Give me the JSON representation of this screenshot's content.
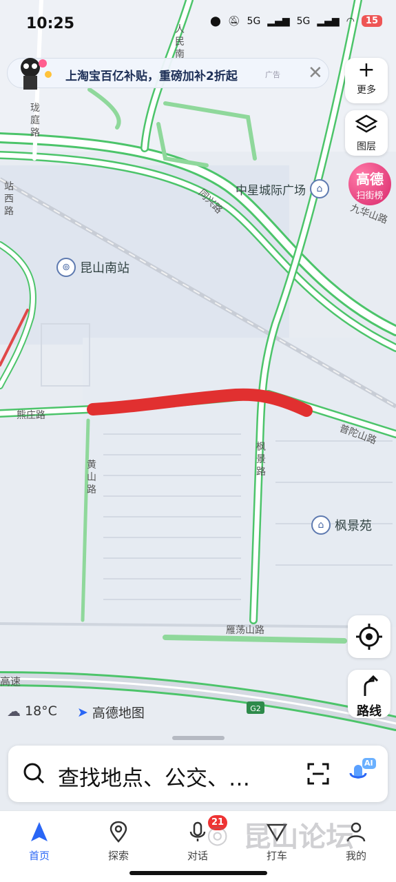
{
  "status": {
    "time": "10:25",
    "signal_1": "5G",
    "signal_2": "5G",
    "battery": "15"
  },
  "banner": {
    "text": "上淘宝百亿补贴，重磅加补2折起",
    "ad_tag": "广告",
    "close": "✕"
  },
  "map": {
    "roads": {
      "longting": "珑庭路",
      "zhanxi": "站西路",
      "renmin_n": "人民南",
      "simiao": "同兴路",
      "xiongzhuang": "熊庄路",
      "huangshan": "黄山路",
      "fengjing": "枫景路",
      "putuoshan": "普陀山路",
      "yandangshan": "雁荡山路",
      "gaosu": "高速",
      "jiuhuashan": "九华山路",
      "g2": "G2"
    },
    "pois": {
      "kunshan_south": "昆山南站",
      "zhongxing": "中星城际广场",
      "fengjingyuan": "枫景苑"
    }
  },
  "side": {
    "more_label": "更多",
    "layers_label": "图层",
    "rank_title": "高德",
    "rank_sub": "扫街榜",
    "route_label": "路线"
  },
  "weather": {
    "temp": "18°C",
    "brand": "高德地图"
  },
  "search": {
    "placeholder": "查找地点、公交、…",
    "ai_badge": "AI"
  },
  "tabs": [
    {
      "label": "首页"
    },
    {
      "label": "探索"
    },
    {
      "label": "对话"
    },
    {
      "label": "打车"
    },
    {
      "label": "我的"
    }
  ],
  "notif_count": "21",
  "watermark": "昆山论坛"
}
